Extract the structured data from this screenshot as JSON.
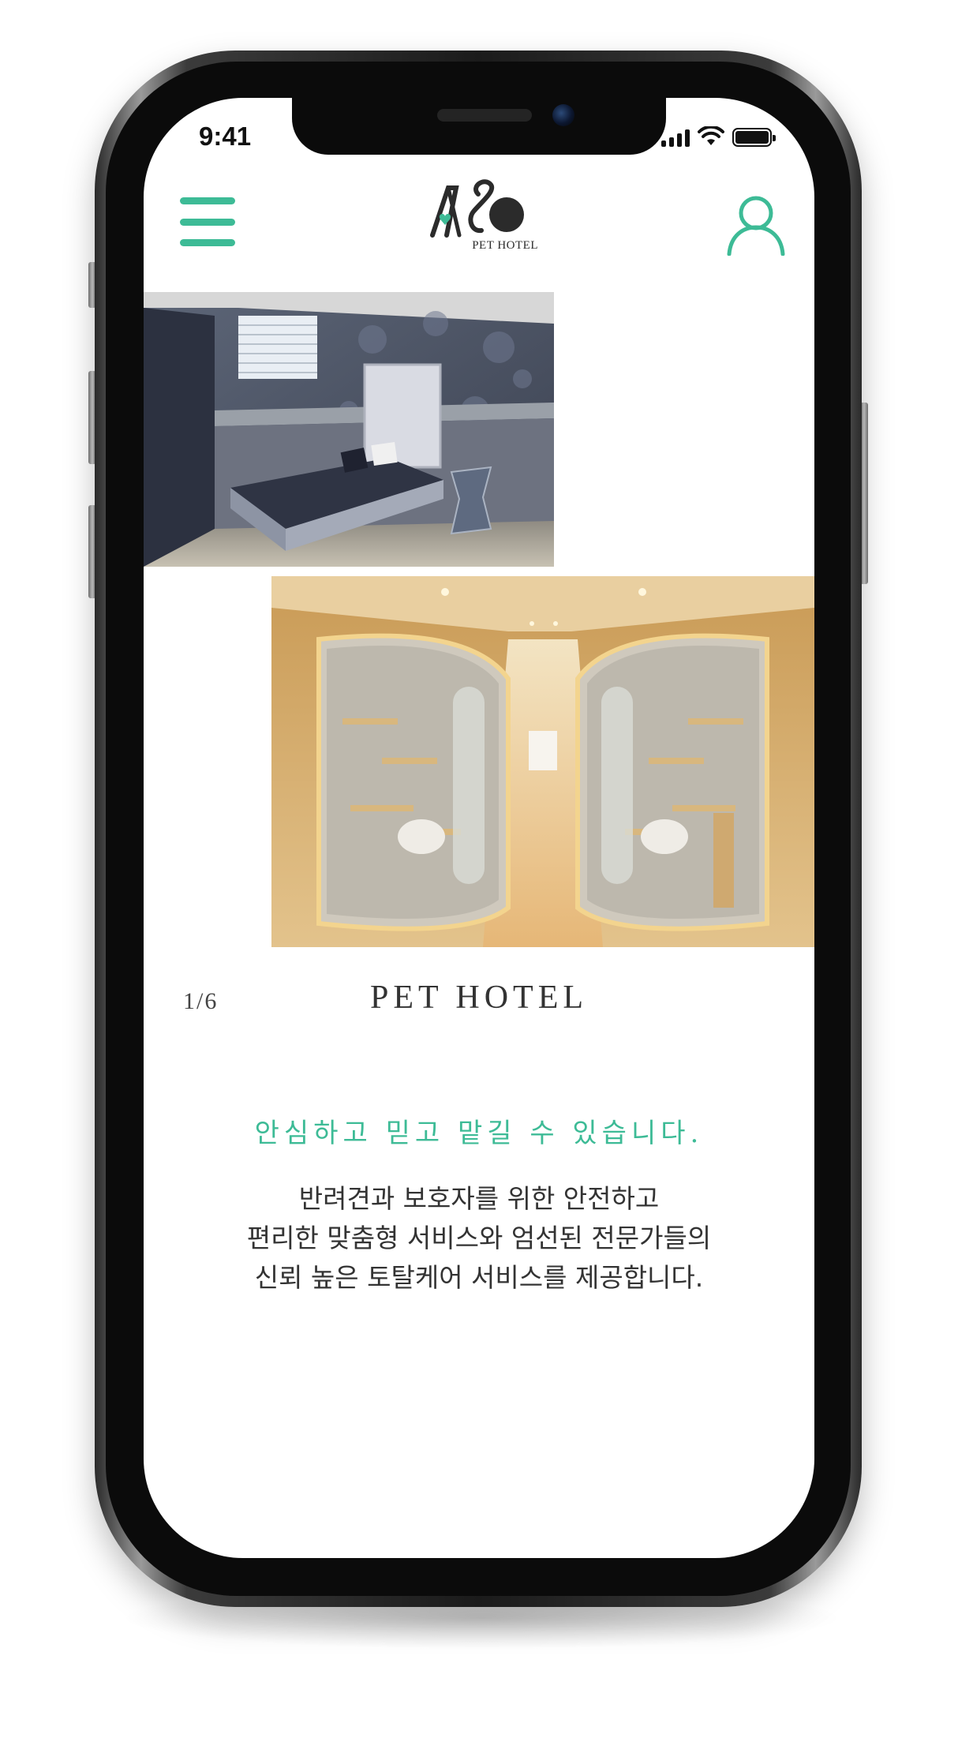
{
  "status_bar": {
    "time": "9:41"
  },
  "header": {
    "logo_text": "PET HOTEL",
    "menu_icon": "hamburger-menu-icon",
    "user_icon": "user-profile-icon",
    "accent_color": "#3dbb96"
  },
  "gallery": {
    "counter": "1/6",
    "title": "PET HOTEL",
    "photos": [
      {
        "name": "dog-room-photo"
      },
      {
        "name": "cat-cabin-corridor-photo"
      }
    ]
  },
  "intro": {
    "tagline": "안심하고 믿고 맡길 수 있습니다.",
    "description_lines": [
      "반려견과 보호자를 위한 안전하고",
      "편리한 맞춤형 서비스와 엄선된 전문가들의",
      "신뢰 높은 토탈케어 서비스를 제공합니다."
    ]
  }
}
